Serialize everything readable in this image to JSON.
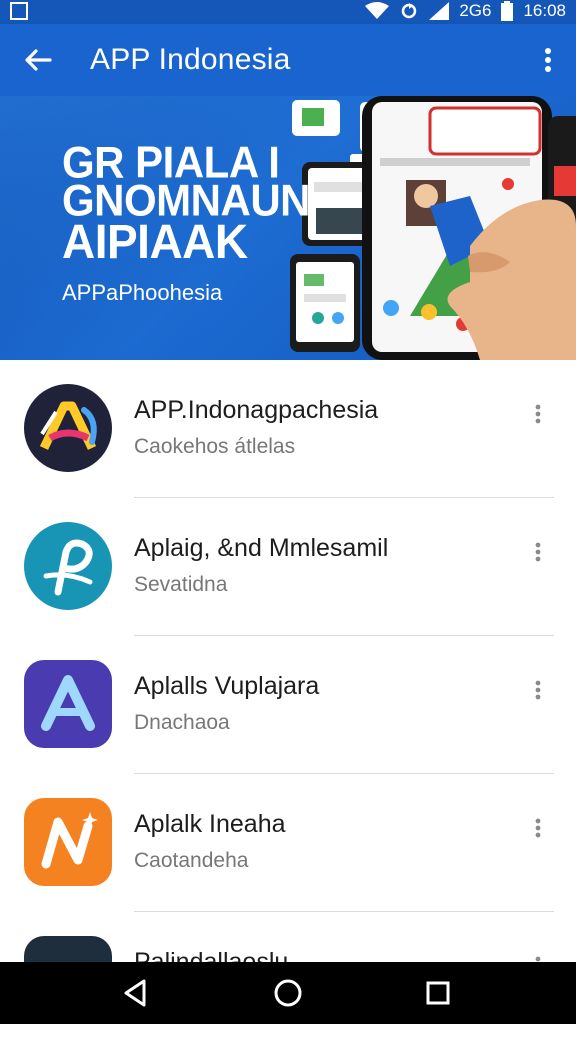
{
  "status_bar": {
    "network_label": "2G6",
    "time": "16:08"
  },
  "app_bar": {
    "title": "APP Indonesia"
  },
  "banner": {
    "headline_lines": [
      "GR PIALA I",
      "GNOMNAUN",
      "AIPIAAK"
    ],
    "subtitle": "APPaPhoohesia"
  },
  "list": {
    "items": [
      {
        "name": "APP.Indonagpachesia",
        "subtitle": "Caokehos átlelas",
        "icon": "app-logo-a-dark"
      },
      {
        "name": "Aplaig, &nd Mmlesamil",
        "subtitle": "Sevatidna",
        "icon": "app-logo-p-teal"
      },
      {
        "name": "Aplalls Vuplajara",
        "subtitle": "Dnachaoa",
        "icon": "app-logo-a-purple"
      },
      {
        "name": "Aplalk Ineaha",
        "subtitle": "Caotandeha",
        "icon": "app-logo-n-orange"
      },
      {
        "name": "Palindallaoslu",
        "subtitle": "",
        "icon": "app-logo-dark"
      }
    ]
  },
  "colors": {
    "app_bar": "#1a64cf",
    "status_bar": "#1557b8",
    "nav_bar": "#000000"
  }
}
